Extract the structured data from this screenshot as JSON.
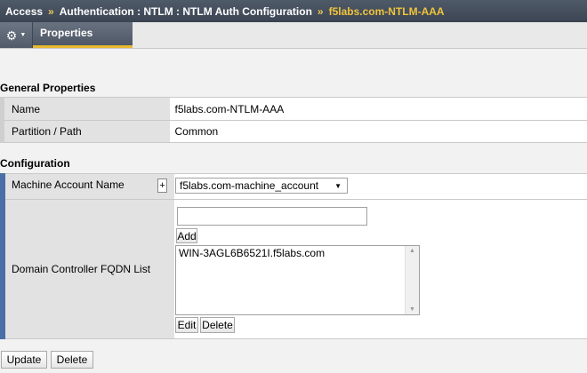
{
  "breadcrumb": {
    "items": [
      "Access",
      "Authentication : NTLM : NTLM Auth Configuration",
      "f5labs.com-NTLM-AAA"
    ],
    "separator": "»"
  },
  "toolbar": {
    "gear_icon": "gear-icon",
    "tab_properties": "Properties"
  },
  "general": {
    "title": "General Properties",
    "rows": [
      {
        "label": "Name",
        "value": "f5labs.com-NTLM-AAA"
      },
      {
        "label": "Partition / Path",
        "value": "Common"
      }
    ]
  },
  "configuration": {
    "title": "Configuration",
    "machine_account": {
      "label": "Machine Account Name",
      "plus": "+",
      "selected": "f5labs.com-machine_account"
    },
    "dc_list": {
      "label": "Domain Controller FQDN List",
      "input_value": "",
      "add_label": "Add",
      "items": [
        "WIN-3AGL6B6521I.f5labs.com"
      ],
      "edit_label": "Edit",
      "delete_label": "Delete"
    }
  },
  "actions": {
    "update_label": "Update",
    "delete_label": "Delete"
  },
  "colors": {
    "header_bg": "#3b4452",
    "accent": "#f0c43c",
    "config_bar": "#4a6ea8"
  }
}
